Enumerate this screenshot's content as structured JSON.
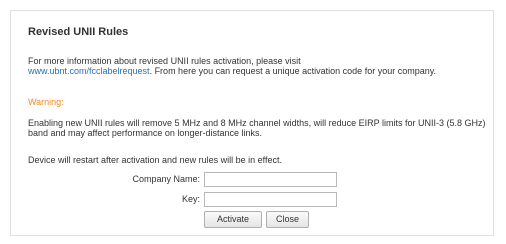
{
  "dialog": {
    "title": "Revised UNII Rules",
    "info_text_before": "For more information about revised UNII rules activation, please visit",
    "info_link": "www.ubnt.com/fcclabelrequest",
    "info_text_after": ". From here you can request a unique activation code for your company.",
    "warning_label": "Warning:",
    "warning_text": "Enabling new UNII rules will remove 5 MHz and 8 MHz channel widths, will reduce EIRP limits for UNII-3 (5.8 GHz) band and may affect performance on longer-distance links.",
    "restart_note": "Device will restart after activation and new rules will be in effect.",
    "company_label": "Company Name:",
    "company_value": "",
    "key_label": "Key:",
    "key_value": "",
    "activate_label": "Activate",
    "close_label": "Close"
  },
  "colors": {
    "warning": "#f08a24",
    "link": "#2a6fb8",
    "text": "#333333"
  }
}
